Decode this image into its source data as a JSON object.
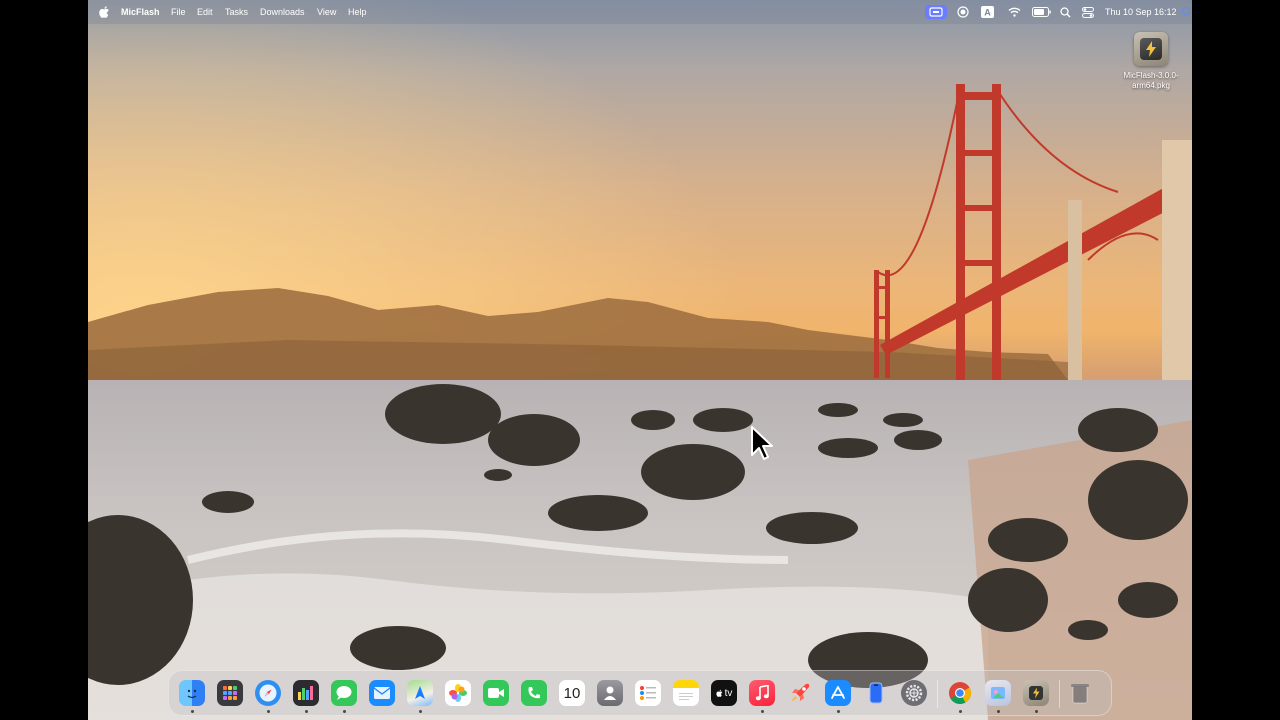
{
  "menubar": {
    "app_name": "MicFlash",
    "menus": [
      "File",
      "Edit",
      "Tasks",
      "Downloads",
      "View",
      "Help"
    ],
    "status_icons": [
      "micflash-status-icon",
      "screen-record-icon",
      "keyboard-input-a-icon",
      "wifi-icon",
      "battery-icon",
      "spotlight-search-icon",
      "control-center-icon"
    ],
    "clock": "Thu 10 Sep  16:12"
  },
  "desktop": {
    "file_label": "MicFlash-3.0.0-arm64.pkg"
  },
  "dock": {
    "calendar_date": "10",
    "tv_label": "tv",
    "apps": [
      "Finder",
      "Launchpad",
      "Safari",
      "Grapher",
      "Messages",
      "Mail",
      "Maps",
      "Photos",
      "FaceTime",
      "Phone",
      "Calendar",
      "Contacts",
      "Reminders",
      "Notes",
      "TV",
      "Music",
      "RocketSim",
      "App Store",
      "iPhone Mirroring",
      "System Settings",
      "Chrome",
      "Preview",
      "MicFlash",
      "Trash"
    ]
  }
}
